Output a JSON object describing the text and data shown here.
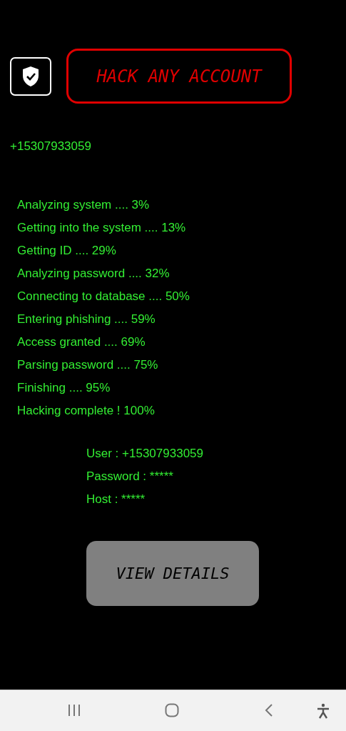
{
  "title": "HACK ANY ACCOUNT",
  "target": "+15307933059",
  "steps": [
    "Analyzing system .... 3%",
    "Getting into the system .... 13%",
    "Getting ID .... 29%",
    "Analyzing password .... 32%",
    "Connecting to database .... 50%",
    "Entering phishing .... 59%",
    "Access granted .... 69%",
    "Parsing password .... 75%",
    "Finishing .... 95%",
    "Hacking complete ! 100%"
  ],
  "details": [
    "User : +15307933059",
    "Password : *****",
    "Host : *****"
  ],
  "button": {
    "label": "VIEW DETAILS",
    "disabled": true
  }
}
